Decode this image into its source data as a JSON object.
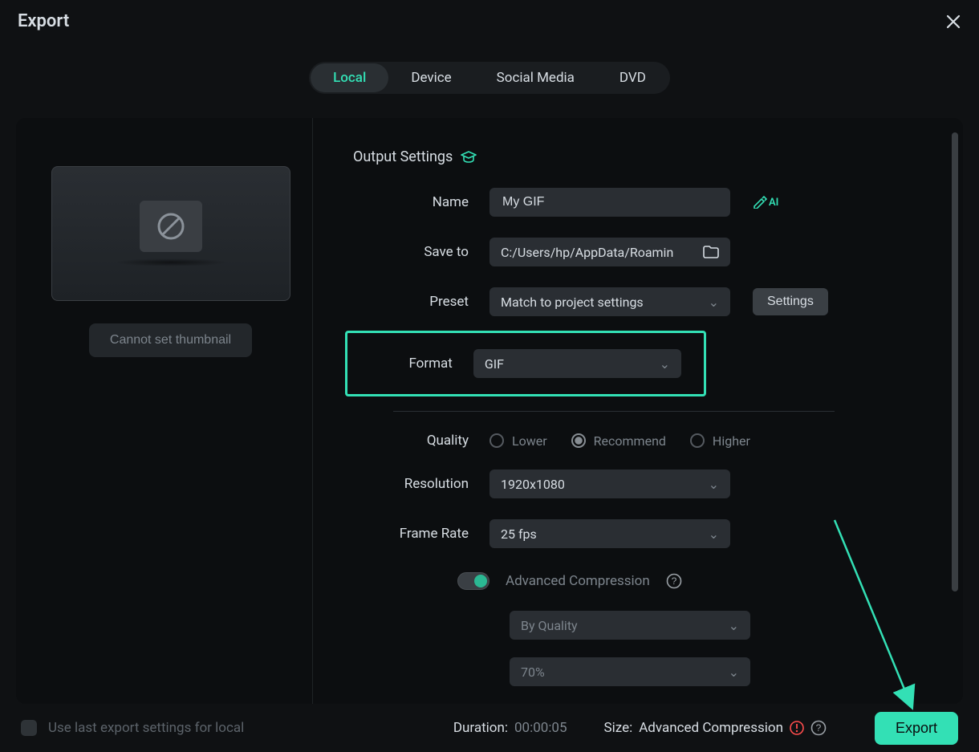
{
  "title": "Export",
  "tabs": {
    "local": "Local",
    "device": "Device",
    "social": "Social Media",
    "dvd": "DVD"
  },
  "thumbnail_btn": "Cannot set thumbnail",
  "section": "Output Settings",
  "labels": {
    "name": "Name",
    "save_to": "Save to",
    "preset": "Preset",
    "format": "Format",
    "quality": "Quality",
    "resolution": "Resolution",
    "frame_rate": "Frame Rate",
    "adv_compression": "Advanced Compression"
  },
  "values": {
    "name": "My GIF",
    "save_to": "C:/Users/hp/AppData/Roamin",
    "preset": "Match to project settings",
    "format": "GIF",
    "resolution": "1920x1080",
    "frame_rate": "25 fps",
    "comp_mode": "By Quality",
    "comp_value": "70%"
  },
  "quality_opts": {
    "lower": "Lower",
    "recommend": "Recommend",
    "higher": "Higher"
  },
  "buttons": {
    "settings": "Settings",
    "export": "Export"
  },
  "ai_label": "AI",
  "footer": {
    "use_last": "Use last export settings for local",
    "duration_label": "Duration:",
    "duration_value": "00:00:05",
    "size_label": "Size:",
    "size_value": "Advanced Compression"
  }
}
